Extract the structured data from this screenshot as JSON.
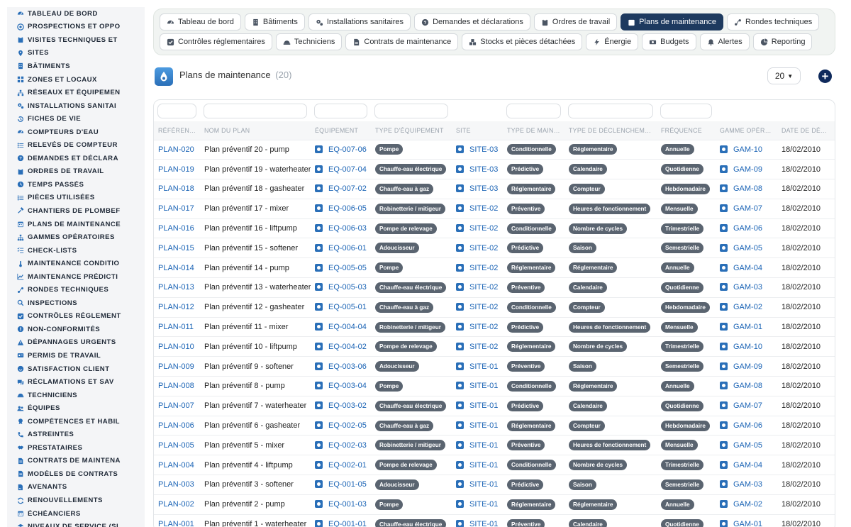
{
  "sidebar": {
    "items": [
      {
        "label": "TABLEAU DE BORD",
        "icon": "gauge-icon"
      },
      {
        "label": "PROSPECTIONS ET OPPO",
        "icon": "target-icon"
      },
      {
        "label": "VISITES TECHNIQUES ET",
        "icon": "clipboard-icon"
      },
      {
        "label": "SITES",
        "icon": "pin-icon"
      },
      {
        "label": "BÂTIMENTS",
        "icon": "building-icon"
      },
      {
        "label": "ZONES ET LOCAUX",
        "icon": "grid-icon"
      },
      {
        "label": "RÉSEAUX ET ÉQUIPEMEN",
        "icon": "network-icon"
      },
      {
        "label": "INSTALLATIONS SANITAI",
        "icon": "cogs-icon"
      },
      {
        "label": "FICHES DE VIE",
        "icon": "history-icon"
      },
      {
        "label": "COMPTEURS D'EAU",
        "icon": "gauge-icon"
      },
      {
        "label": "RELEVÉS DE COMPTEUR",
        "icon": "list-icon"
      },
      {
        "label": "DEMANDES ET DÉCLARA",
        "icon": "question-icon"
      },
      {
        "label": "ORDRES DE TRAVAIL",
        "icon": "clipboard-icon"
      },
      {
        "label": "TEMPS PASSÉS",
        "icon": "clock-icon"
      },
      {
        "label": "PIÈCES UTILISÉES",
        "icon": "list-icon"
      },
      {
        "label": "CHANTIERS DE PLOMBEF",
        "icon": "hammer-icon"
      },
      {
        "label": "PLANS DE MAINTENANCE",
        "icon": "calendar-icon"
      },
      {
        "label": "GAMMES OPÉRATOIRES",
        "icon": "sitemap-icon"
      },
      {
        "label": "CHECK-LISTS",
        "icon": "checklist-icon"
      },
      {
        "label": "MAINTENANCE CONDITIO",
        "icon": "thermometer-icon"
      },
      {
        "label": "MAINTENANCE PRÉDICTI",
        "icon": "chart-icon"
      },
      {
        "label": "RONDES TECHNIQUES",
        "icon": "route-icon"
      },
      {
        "label": "INSPECTIONS",
        "icon": "search-icon"
      },
      {
        "label": "CONTRÔLES RÉGLEMENT",
        "icon": "check-square-icon"
      },
      {
        "label": "NON-CONFORMITÉS",
        "icon": "alert-circle-icon"
      },
      {
        "label": "DÉPANNAGES URGENTS",
        "icon": "warning-icon"
      },
      {
        "label": "PERMIS DE TRAVAIL",
        "icon": "id-card-icon"
      },
      {
        "label": "SATISFACTION CLIENT",
        "icon": "smile-icon"
      },
      {
        "label": "RÉCLAMATIONS ET SAV",
        "icon": "comments-icon"
      },
      {
        "label": "TECHNICIENS",
        "icon": "hardhat-icon"
      },
      {
        "label": "ÉQUIPES",
        "icon": "users-icon"
      },
      {
        "label": "COMPÉTENCES ET HABIL",
        "icon": "certificate-icon"
      },
      {
        "label": "ASTREINTES",
        "icon": "phone-icon"
      },
      {
        "label": "PRESTATAIRES",
        "icon": "handshake-icon"
      },
      {
        "label": "CONTRATS DE MAINTENA",
        "icon": "file-icon"
      },
      {
        "label": "MODÈLES DE CONTRATS",
        "icon": "file-icon"
      },
      {
        "label": "AVENANTS",
        "icon": "file-signature-icon"
      },
      {
        "label": "RENOUVELLEMENTS",
        "icon": "refresh-icon"
      },
      {
        "label": "ÉCHÉANCIERS",
        "icon": "calendar-icon"
      },
      {
        "label": "NIVEAUX DE SERVICE (SI",
        "icon": "layers-icon"
      }
    ]
  },
  "tabs": {
    "row1": [
      {
        "label": "Tableau de bord",
        "icon": "gauge-icon",
        "active": false
      },
      {
        "label": "Bâtiments",
        "icon": "building-icon",
        "active": false
      },
      {
        "label": "Installations sanitaires",
        "icon": "cogs-icon",
        "active": false
      },
      {
        "label": "Demandes et déclarations",
        "icon": "question-icon",
        "active": false
      },
      {
        "label": "Ordres de travail",
        "icon": "clipboard-icon",
        "active": false
      },
      {
        "label": "Plans de maintenance",
        "icon": "calendar-icon",
        "active": true
      },
      {
        "label": "Rondes techniques",
        "icon": "route-icon",
        "active": false
      }
    ],
    "row2": [
      {
        "label": "Contrôles réglementaires",
        "icon": "check-square-icon",
        "active": false
      },
      {
        "label": "Techniciens",
        "icon": "hardhat-icon",
        "active": false
      },
      {
        "label": "Contrats de maintenance",
        "icon": "file-icon",
        "active": false
      },
      {
        "label": "Stocks et pièces détachées",
        "icon": "boxes-icon",
        "active": false
      },
      {
        "label": "Énergie",
        "icon": "bolt-icon",
        "active": false
      },
      {
        "label": "Budgets",
        "icon": "money-icon",
        "active": false
      },
      {
        "label": "Alertes",
        "icon": "bell-icon",
        "active": false
      },
      {
        "label": "Reporting",
        "icon": "pie-icon",
        "active": false
      }
    ]
  },
  "header": {
    "title": "Plans de maintenance",
    "count": "(20)",
    "per_page": "20"
  },
  "table": {
    "columns": [
      "RÉFÉRENCE",
      "NOM DU PLAN",
      "ÉQUIPEMENT",
      "TYPE D'ÉQUIPEMENT",
      "SITE",
      "TYPE DE MAINT...",
      "TYPE DE DÉCLENCHEMENT",
      "FRÉQUENCE",
      "GAMME OPÉRA...",
      "DATE DE DÉBUT"
    ],
    "rows": [
      {
        "ref": "PLAN-020",
        "name": "Plan préventif 20 - pump",
        "equip": "EQ-007-06",
        "equip_type": "Pompe",
        "site": "SITE-03",
        "maint": "Conditionnelle",
        "trigger": "Réglementaire",
        "freq": "Annuelle",
        "gamme": "GAM-10",
        "date": "18/02/2010"
      },
      {
        "ref": "PLAN-019",
        "name": "Plan préventif 19 - waterheater",
        "equip": "EQ-007-04",
        "equip_type": "Chauffe-eau électrique",
        "site": "SITE-03",
        "maint": "Prédictive",
        "trigger": "Calendaire",
        "freq": "Quotidienne",
        "gamme": "GAM-09",
        "date": "18/02/2010"
      },
      {
        "ref": "PLAN-018",
        "name": "Plan préventif 18 - gasheater",
        "equip": "EQ-007-02",
        "equip_type": "Chauffe-eau à gaz",
        "site": "SITE-03",
        "maint": "Réglementaire",
        "trigger": "Compteur",
        "freq": "Hebdomadaire",
        "gamme": "GAM-08",
        "date": "18/02/2010"
      },
      {
        "ref": "PLAN-017",
        "name": "Plan préventif 17 - mixer",
        "equip": "EQ-006-05",
        "equip_type": "Robinetterie / mitigeur",
        "site": "SITE-02",
        "maint": "Préventive",
        "trigger": "Heures de fonctionnement",
        "freq": "Mensuelle",
        "gamme": "GAM-07",
        "date": "18/02/2010"
      },
      {
        "ref": "PLAN-016",
        "name": "Plan préventif 16 - liftpump",
        "equip": "EQ-006-03",
        "equip_type": "Pompe de relevage",
        "site": "SITE-02",
        "maint": "Conditionnelle",
        "trigger": "Nombre de cycles",
        "freq": "Trimestrielle",
        "gamme": "GAM-06",
        "date": "18/02/2010"
      },
      {
        "ref": "PLAN-015",
        "name": "Plan préventif 15 - softener",
        "equip": "EQ-006-01",
        "equip_type": "Adoucisseur",
        "site": "SITE-02",
        "maint": "Prédictive",
        "trigger": "Saison",
        "freq": "Semestrielle",
        "gamme": "GAM-05",
        "date": "18/02/2010"
      },
      {
        "ref": "PLAN-014",
        "name": "Plan préventif 14 - pump",
        "equip": "EQ-005-05",
        "equip_type": "Pompe",
        "site": "SITE-02",
        "maint": "Réglementaire",
        "trigger": "Réglementaire",
        "freq": "Annuelle",
        "gamme": "GAM-04",
        "date": "18/02/2010"
      },
      {
        "ref": "PLAN-013",
        "name": "Plan préventif 13 - waterheater",
        "equip": "EQ-005-03",
        "equip_type": "Chauffe-eau électrique",
        "site": "SITE-02",
        "maint": "Préventive",
        "trigger": "Calendaire",
        "freq": "Quotidienne",
        "gamme": "GAM-03",
        "date": "18/02/2010"
      },
      {
        "ref": "PLAN-012",
        "name": "Plan préventif 12 - gasheater",
        "equip": "EQ-005-01",
        "equip_type": "Chauffe-eau à gaz",
        "site": "SITE-02",
        "maint": "Conditionnelle",
        "trigger": "Compteur",
        "freq": "Hebdomadaire",
        "gamme": "GAM-02",
        "date": "18/02/2010"
      },
      {
        "ref": "PLAN-011",
        "name": "Plan préventif 11 - mixer",
        "equip": "EQ-004-04",
        "equip_type": "Robinetterie / mitigeur",
        "site": "SITE-02",
        "maint": "Prédictive",
        "trigger": "Heures de fonctionnement",
        "freq": "Mensuelle",
        "gamme": "GAM-01",
        "date": "18/02/2010"
      },
      {
        "ref": "PLAN-010",
        "name": "Plan préventif 10 - liftpump",
        "equip": "EQ-004-02",
        "equip_type": "Pompe de relevage",
        "site": "SITE-02",
        "maint": "Réglementaire",
        "trigger": "Nombre de cycles",
        "freq": "Trimestrielle",
        "gamme": "GAM-10",
        "date": "18/02/2010"
      },
      {
        "ref": "PLAN-009",
        "name": "Plan préventif 9 - softener",
        "equip": "EQ-003-06",
        "equip_type": "Adoucisseur",
        "site": "SITE-01",
        "maint": "Préventive",
        "trigger": "Saison",
        "freq": "Semestrielle",
        "gamme": "GAM-09",
        "date": "18/02/2010"
      },
      {
        "ref": "PLAN-008",
        "name": "Plan préventif 8 - pump",
        "equip": "EQ-003-04",
        "equip_type": "Pompe",
        "site": "SITE-01",
        "maint": "Conditionnelle",
        "trigger": "Réglementaire",
        "freq": "Annuelle",
        "gamme": "GAM-08",
        "date": "18/02/2010"
      },
      {
        "ref": "PLAN-007",
        "name": "Plan préventif 7 - waterheater",
        "equip": "EQ-003-02",
        "equip_type": "Chauffe-eau électrique",
        "site": "SITE-01",
        "maint": "Prédictive",
        "trigger": "Calendaire",
        "freq": "Quotidienne",
        "gamme": "GAM-07",
        "date": "18/02/2010"
      },
      {
        "ref": "PLAN-006",
        "name": "Plan préventif 6 - gasheater",
        "equip": "EQ-002-05",
        "equip_type": "Chauffe-eau à gaz",
        "site": "SITE-01",
        "maint": "Réglementaire",
        "trigger": "Compteur",
        "freq": "Hebdomadaire",
        "gamme": "GAM-06",
        "date": "18/02/2010"
      },
      {
        "ref": "PLAN-005",
        "name": "Plan préventif 5 - mixer",
        "equip": "EQ-002-03",
        "equip_type": "Robinetterie / mitigeur",
        "site": "SITE-01",
        "maint": "Préventive",
        "trigger": "Heures de fonctionnement",
        "freq": "Mensuelle",
        "gamme": "GAM-05",
        "date": "18/02/2010"
      },
      {
        "ref": "PLAN-004",
        "name": "Plan préventif 4 - liftpump",
        "equip": "EQ-002-01",
        "equip_type": "Pompe de relevage",
        "site": "SITE-01",
        "maint": "Conditionnelle",
        "trigger": "Nombre de cycles",
        "freq": "Trimestrielle",
        "gamme": "GAM-04",
        "date": "18/02/2010"
      },
      {
        "ref": "PLAN-003",
        "name": "Plan préventif 3 - softener",
        "equip": "EQ-001-05",
        "equip_type": "Adoucisseur",
        "site": "SITE-01",
        "maint": "Prédictive",
        "trigger": "Saison",
        "freq": "Semestrielle",
        "gamme": "GAM-03",
        "date": "18/02/2010"
      },
      {
        "ref": "PLAN-002",
        "name": "Plan préventif 2 - pump",
        "equip": "EQ-001-03",
        "equip_type": "Pompe",
        "site": "SITE-01",
        "maint": "Réglementaire",
        "trigger": "Réglementaire",
        "freq": "Annuelle",
        "gamme": "GAM-02",
        "date": "18/02/2010"
      },
      {
        "ref": "PLAN-001",
        "name": "Plan préventif 1 - waterheater",
        "equip": "EQ-001-01",
        "equip_type": "Chauffe-eau électrique",
        "site": "SITE-01",
        "maint": "Préventive",
        "trigger": "Calendaire",
        "freq": "Quotidienne",
        "gamme": "GAM-01",
        "date": "18/02/2010"
      }
    ]
  },
  "colors": {
    "accent": "#1a63b5",
    "active_tab": "#1e3a5f",
    "chip": "#5a6470",
    "add_button": "#0f2a5c"
  }
}
